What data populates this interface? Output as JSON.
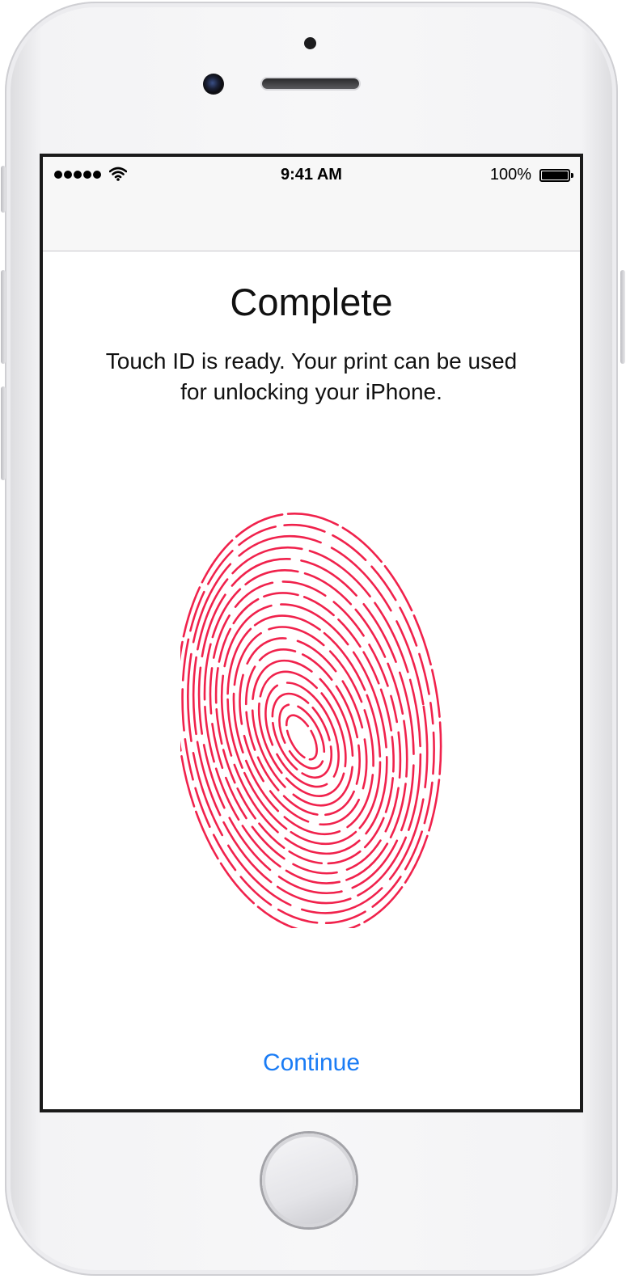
{
  "status_bar": {
    "signal_icon": "cellular-signal-5-dots",
    "wifi_icon": "wifi-icon",
    "time": "9:41 AM",
    "battery_percent": "100%",
    "battery_level": 1.0
  },
  "page": {
    "title": "Complete",
    "message_line1": "Touch ID is ready. Your print can be used",
    "message_line2": "for unlocking your iPhone.",
    "continue_label": "Continue"
  },
  "icons": {
    "fingerprint": "fingerprint-icon"
  },
  "colors": {
    "fingerprint": "#f0224c",
    "link": "#1a7cf5",
    "bars_background": "#f7f7f7"
  }
}
